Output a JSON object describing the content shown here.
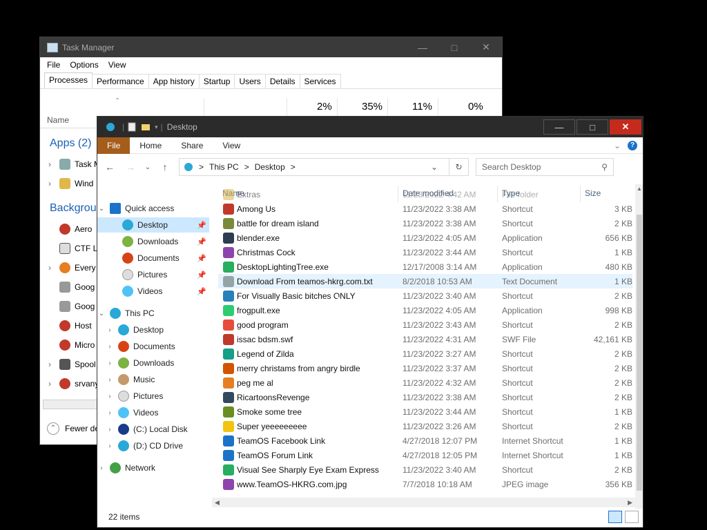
{
  "task_manager": {
    "title": "Task Manager",
    "menu": [
      "File",
      "Options",
      "View"
    ],
    "tabs": [
      "Processes",
      "Performance",
      "App history",
      "Startup",
      "Users",
      "Details",
      "Services"
    ],
    "percentages": [
      "2%",
      "35%",
      "11%",
      "0%"
    ],
    "name_header": "Name",
    "apps_group": "Apps (2)",
    "background_group": "Backgroun",
    "apps": [
      "Task M",
      "Wind"
    ],
    "background": [
      "Aero",
      "CTF L",
      "Every",
      "Goog",
      "Goog",
      "Host",
      "Micro",
      "Spool",
      "srvany"
    ],
    "fewer_details": "Fewer de"
  },
  "explorer": {
    "title": "Desktop",
    "ribbon_tabs": [
      "File",
      "Home",
      "Share",
      "View"
    ],
    "help_icon": "?",
    "address": {
      "this_pc": "This PC",
      "desktop": "Desktop",
      "sep": ">"
    },
    "search_placeholder": "Search Desktop",
    "nav": {
      "quick_access": "Quick access",
      "quick_items": [
        "Desktop",
        "Downloads",
        "Documents",
        "Pictures",
        "Videos"
      ],
      "this_pc": "This PC",
      "pc_items": [
        "Desktop",
        "Documents",
        "Downloads",
        "Music",
        "Pictures",
        "Videos",
        "(C:) Local Disk",
        "(D:) CD Drive"
      ],
      "network": "Network"
    },
    "columns": {
      "name": "Name",
      "date": "Date modified",
      "type": "Type",
      "size": "Size"
    },
    "files": [
      {
        "name": "Extras",
        "date": "11/23/2022 4:42 AM",
        "type": "File folder",
        "size": "",
        "color": "#d9b44a"
      },
      {
        "name": "Among Us",
        "date": "11/23/2022 3:38 AM",
        "type": "Shortcut",
        "size": "3 KB",
        "color": "#c0392b"
      },
      {
        "name": "battle for dream island",
        "date": "11/23/2022 3:38 AM",
        "type": "Shortcut",
        "size": "2 KB",
        "color": "#7a8a3a"
      },
      {
        "name": "blender.exe",
        "date": "11/23/2022 4:05 AM",
        "type": "Application",
        "size": "656 KB",
        "color": "#2c3e50"
      },
      {
        "name": "Christmas Cock",
        "date": "11/23/2022 3:44 AM",
        "type": "Shortcut",
        "size": "1 KB",
        "color": "#8e44ad"
      },
      {
        "name": "DesktopLightingTree.exe",
        "date": "12/17/2008 3:14 AM",
        "type": "Application",
        "size": "480 KB",
        "color": "#27ae60"
      },
      {
        "name": "Download From teamos-hkrg.com.txt",
        "date": "8/2/2018 10:53 AM",
        "type": "Text Document",
        "size": "1 KB",
        "color": "#95a5a6"
      },
      {
        "name": "For Visually Basic bitches ONLY",
        "date": "11/23/2022 3:40 AM",
        "type": "Shortcut",
        "size": "2 KB",
        "color": "#2980b9"
      },
      {
        "name": "frogpult.exe",
        "date": "11/23/2022 4:05 AM",
        "type": "Application",
        "size": "998 KB",
        "color": "#2ecc71"
      },
      {
        "name": "good program",
        "date": "11/23/2022 3:43 AM",
        "type": "Shortcut",
        "size": "2 KB",
        "color": "#e74c3c"
      },
      {
        "name": "issac bdsm.swf",
        "date": "11/23/2022 4:31 AM",
        "type": "SWF File",
        "size": "42,161 KB",
        "color": "#c0392b"
      },
      {
        "name": "Legend of Zilda",
        "date": "11/23/2022 3:27 AM",
        "type": "Shortcut",
        "size": "2 KB",
        "color": "#16a085"
      },
      {
        "name": "merry christams from angry birdle",
        "date": "11/23/2022 3:37 AM",
        "type": "Shortcut",
        "size": "2 KB",
        "color": "#d35400"
      },
      {
        "name": "peg me al",
        "date": "11/23/2022 4:32 AM",
        "type": "Shortcut",
        "size": "2 KB",
        "color": "#e67e22"
      },
      {
        "name": "RicartoonsRevenge",
        "date": "11/23/2022 3:38 AM",
        "type": "Shortcut",
        "size": "2 KB",
        "color": "#34495e"
      },
      {
        "name": "Smoke some tree",
        "date": "11/23/2022 3:44 AM",
        "type": "Shortcut",
        "size": "1 KB",
        "color": "#6b8e23"
      },
      {
        "name": "Super yeeeeeeeee",
        "date": "11/23/2022 3:26 AM",
        "type": "Shortcut",
        "size": "2 KB",
        "color": "#f1c40f"
      },
      {
        "name": "TeamOS Facebook Link",
        "date": "4/27/2018 12:07 PM",
        "type": "Internet Shortcut",
        "size": "1 KB",
        "color": "#1a73c8"
      },
      {
        "name": "TeamOS Forum Link",
        "date": "4/27/2018 12:05 PM",
        "type": "Internet Shortcut",
        "size": "1 KB",
        "color": "#1a73c8"
      },
      {
        "name": "Visual See Sharply Eye Exam Express",
        "date": "11/23/2022 3:40 AM",
        "type": "Shortcut",
        "size": "2 KB",
        "color": "#27ae60"
      },
      {
        "name": "www.TeamOS-HKRG.com.jpg",
        "date": "7/7/2018 10:18 AM",
        "type": "JPEG image",
        "size": "356 KB",
        "color": "#8e44ad"
      }
    ],
    "status": "22 items"
  }
}
